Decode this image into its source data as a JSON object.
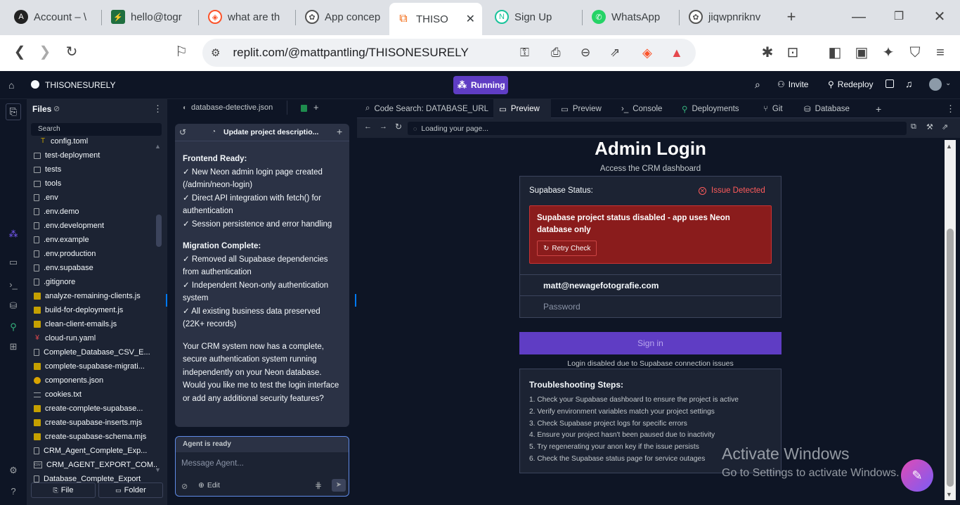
{
  "browser": {
    "tabs": [
      {
        "label": "Account – \\",
        "icon": "account-icon"
      },
      {
        "label": "hello@togr",
        "icon": "lightning-icon"
      },
      {
        "label": "what are th",
        "icon": "brave-icon"
      },
      {
        "label": "App concep",
        "icon": "openai-icon"
      },
      {
        "label": "THISO",
        "icon": "replit-icon"
      },
      {
        "label": "Sign Up",
        "icon": "neon-icon"
      },
      {
        "label": "WhatsApp",
        "icon": "whatsapp-icon"
      },
      {
        "label": "jiqwpnriknv",
        "icon": "openai-icon"
      }
    ],
    "url": "replit.com/@mattpantling/THISONESURELY"
  },
  "replit": {
    "project_name": "THISONESURELY",
    "run_status": "Running",
    "invite_label": "Invite",
    "redeploy_label": "Redeploy"
  },
  "files": {
    "title": "Files",
    "search_label": "Search",
    "items": [
      {
        "name": "config.toml",
        "type": "toml"
      },
      {
        "name": "test-deployment",
        "type": "folder"
      },
      {
        "name": "tests",
        "type": "folder"
      },
      {
        "name": "tools",
        "type": "folder"
      },
      {
        "name": ".env",
        "type": "file"
      },
      {
        "name": ".env.demo",
        "type": "file"
      },
      {
        "name": ".env.development",
        "type": "file"
      },
      {
        "name": ".env.example",
        "type": "file"
      },
      {
        "name": ".env.production",
        "type": "file"
      },
      {
        "name": ".env.supabase",
        "type": "file"
      },
      {
        "name": ".gitignore",
        "type": "file"
      },
      {
        "name": "analyze-remaining-clients.js",
        "type": "js"
      },
      {
        "name": "build-for-deployment.js",
        "type": "js"
      },
      {
        "name": "clean-client-emails.js",
        "type": "js"
      },
      {
        "name": "cloud-run.yaml",
        "type": "yaml"
      },
      {
        "name": "Complete_Database_CSV_E...",
        "type": "file"
      },
      {
        "name": "complete-supabase-migrati...",
        "type": "js"
      },
      {
        "name": "components.json",
        "type": "json"
      },
      {
        "name": "cookies.txt",
        "type": "txt"
      },
      {
        "name": "create-complete-supabase...",
        "type": "js"
      },
      {
        "name": "create-supabase-inserts.mjs",
        "type": "js"
      },
      {
        "name": "create-supabase-schema.mjs",
        "type": "js"
      },
      {
        "name": "CRM_Agent_Complete_Exp...",
        "type": "file"
      },
      {
        "name": "CRM_AGENT_EXPORT_COM...",
        "type": "csv"
      },
      {
        "name": "Database_Complete_Export",
        "type": "file"
      }
    ],
    "new_file_label": "File",
    "new_folder_label": "Folder"
  },
  "agent": {
    "file_tab": "database-detective.json",
    "thread_title": "Update project descriptio...",
    "sections": [
      {
        "heading": "Frontend Ready:",
        "lines": [
          "✓ New Neon admin login page created (/admin/neon-login)",
          "✓ Direct API integration with fetch() for authentication",
          "✓ Session persistence and error handling"
        ]
      },
      {
        "heading": "Migration Complete:",
        "lines": [
          "✓ Removed all Supabase dependencies from authentication",
          "✓ Independent Neon-only authentication system",
          "✓ All existing business data preserved (22K+ records)"
        ]
      }
    ],
    "closing": "Your CRM system now has a complete, secure authentication system running independently on your Neon database. Would you like me to test the login interface or add any additional security features?",
    "status": "Agent is ready",
    "input_placeholder": "Message Agent...",
    "edit_label": "Edit"
  },
  "workspace_tabs": [
    {
      "label": "Code Search: DATABASE_URL",
      "icon": "search-icon"
    },
    {
      "label": "Preview",
      "icon": "preview-icon"
    },
    {
      "label": "Preview",
      "icon": "preview-icon"
    },
    {
      "label": "Console",
      "icon": "console-icon"
    },
    {
      "label": "Deployments",
      "icon": "deploy-icon"
    },
    {
      "label": "Git",
      "icon": "git-icon"
    },
    {
      "label": "Database",
      "icon": "database-icon"
    }
  ],
  "preview": {
    "url_status": "Loading your page...",
    "title": "Admin Login",
    "subtitle": "Access the CRM dashboard",
    "status_label": "Supabase Status:",
    "status_value": "Issue Detected",
    "error_message": "Supabase project status disabled - app uses Neon database only",
    "retry_label": "Retry Check",
    "email_value": "matt@newagefotografie.com",
    "password_placeholder": "Password",
    "signin_label": "Sign in",
    "disabled_note": "Login disabled due to Supabase connection issues",
    "troubleshoot_title": "Troubleshooting Steps:",
    "steps": [
      "1. Check your Supabase dashboard to ensure the project is active",
      "2. Verify environment variables match your project settings",
      "3. Check Supabase project logs for specific errors",
      "4. Ensure your project hasn't been paused due to inactivity",
      "5. Try regenerating your anon key if the issue persists",
      "6. Check the Supabase status page for service outages"
    ]
  },
  "watermark": {
    "line1": "Activate Windows",
    "line2": "Go to Settings to activate Windows."
  },
  "colors": {
    "accent": "#5f3dc4",
    "error_bg": "#8a1c1c",
    "error_text": "#ff5b5b",
    "panel": "#2b3245"
  }
}
